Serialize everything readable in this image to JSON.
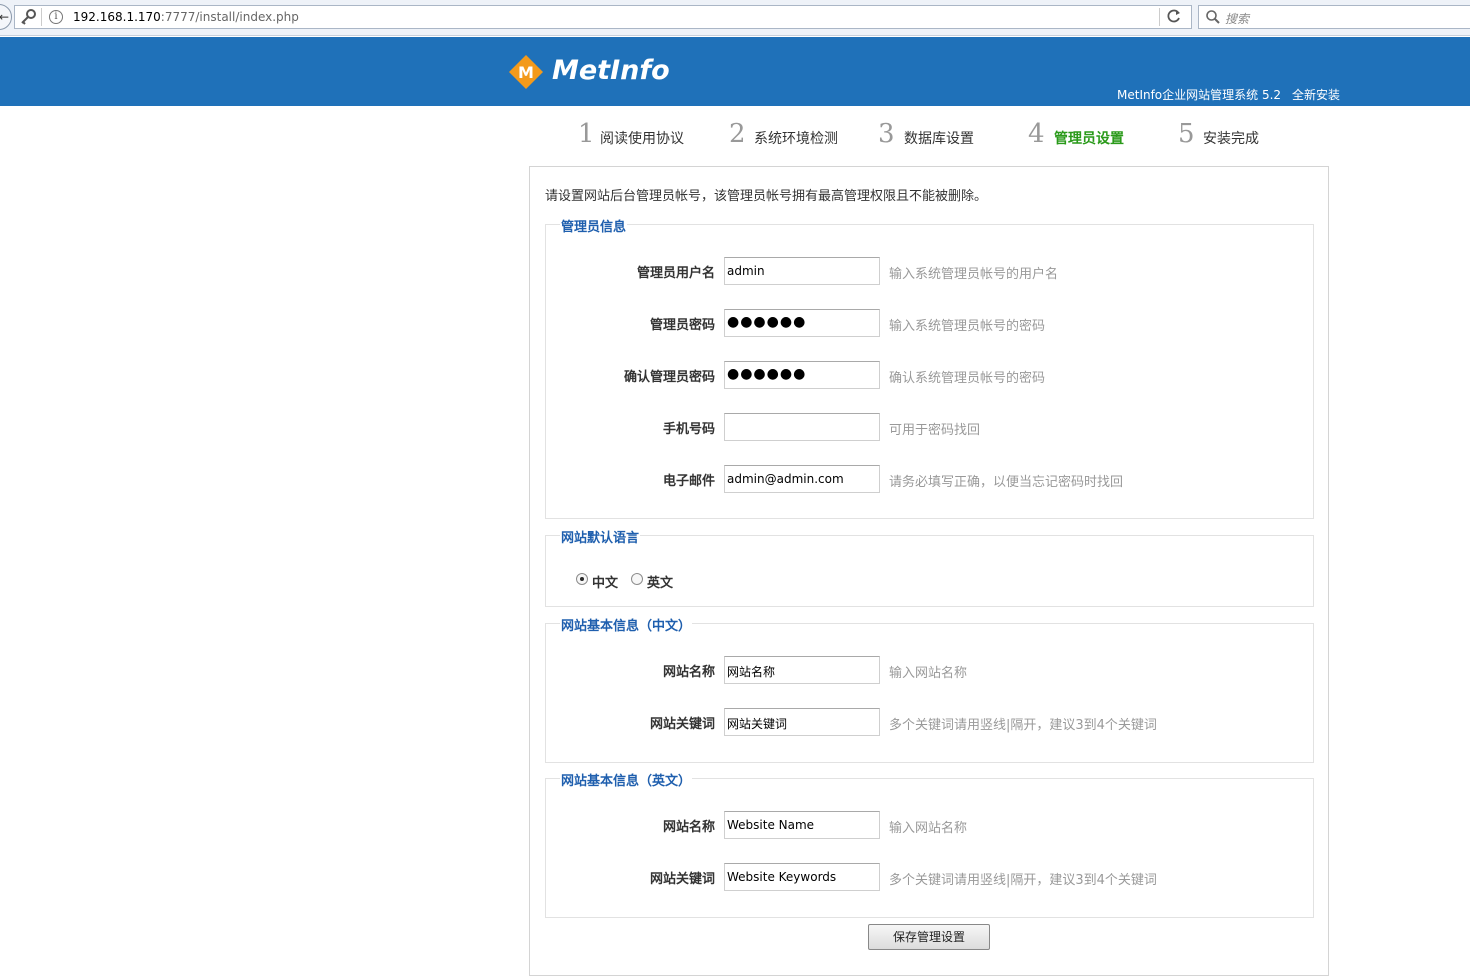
{
  "browser": {
    "nav_back_glyph": "←",
    "url_host": "192.168.1.170",
    "url_path": ":7777/install/index.php",
    "search_placeholder": "搜索"
  },
  "header": {
    "logo_letter": "M",
    "logo_text": "MetInfo",
    "system_name": "MetInfo企业网站管理系统 5.2",
    "install_mode": "全新安装",
    "band_color": "#1f71b9",
    "logo_color": "#f39a1b"
  },
  "steps": [
    {
      "num": "1",
      "label": "阅读使用协议",
      "active": false
    },
    {
      "num": "2",
      "label": "系统环境检测",
      "active": false
    },
    {
      "num": "3",
      "label": "数据库设置",
      "active": false
    },
    {
      "num": "4",
      "label": "管理员设置",
      "active": true
    },
    {
      "num": "5",
      "label": "安装完成",
      "active": false
    }
  ],
  "intro": "请设置网站后台管理员帐号，该管理员帐号拥有最高管理权限且不能被删除。",
  "admin_section": {
    "title": "管理员信息",
    "fields": [
      {
        "label": "管理员用户名",
        "value": "admin",
        "hint": "输入系统管理员帐号的用户名"
      },
      {
        "label": "管理员密码",
        "value": "●●●●●●",
        "hint": "输入系统管理员帐号的密码"
      },
      {
        "label": "确认管理员密码",
        "value": "●●●●●●",
        "hint": "确认系统管理员帐号的密码"
      },
      {
        "label": "手机号码",
        "value": "",
        "hint": "可用于密码找回"
      },
      {
        "label": "电子邮件",
        "value": "admin@admin.com",
        "hint": "请务必填写正确，以便当忘记密码时找回"
      }
    ]
  },
  "lang_section": {
    "title": "网站默认语言",
    "options": [
      {
        "label": "中文",
        "checked": true
      },
      {
        "label": "英文",
        "checked": false
      }
    ]
  },
  "cn_section": {
    "title": "网站基本信息（中文）",
    "fields": [
      {
        "label": "网站名称",
        "value": "网站名称",
        "hint": "输入网站名称"
      },
      {
        "label": "网站关键词",
        "value": "网站关键词",
        "hint": "多个关键词请用竖线|隔开，建议3到4个关键词"
      }
    ]
  },
  "en_section": {
    "title": "网站基本信息（英文）",
    "fields": [
      {
        "label": "网站名称",
        "value": "Website Name",
        "hint": "输入网站名称"
      },
      {
        "label": "网站关键词",
        "value": "Website Keywords",
        "hint": "多个关键词请用竖线|隔开，建议3到4个关键词"
      }
    ]
  },
  "save_label": "保存管理设置",
  "active_step_color": "#2a9a1a",
  "section_title_color": "#1f5fae"
}
